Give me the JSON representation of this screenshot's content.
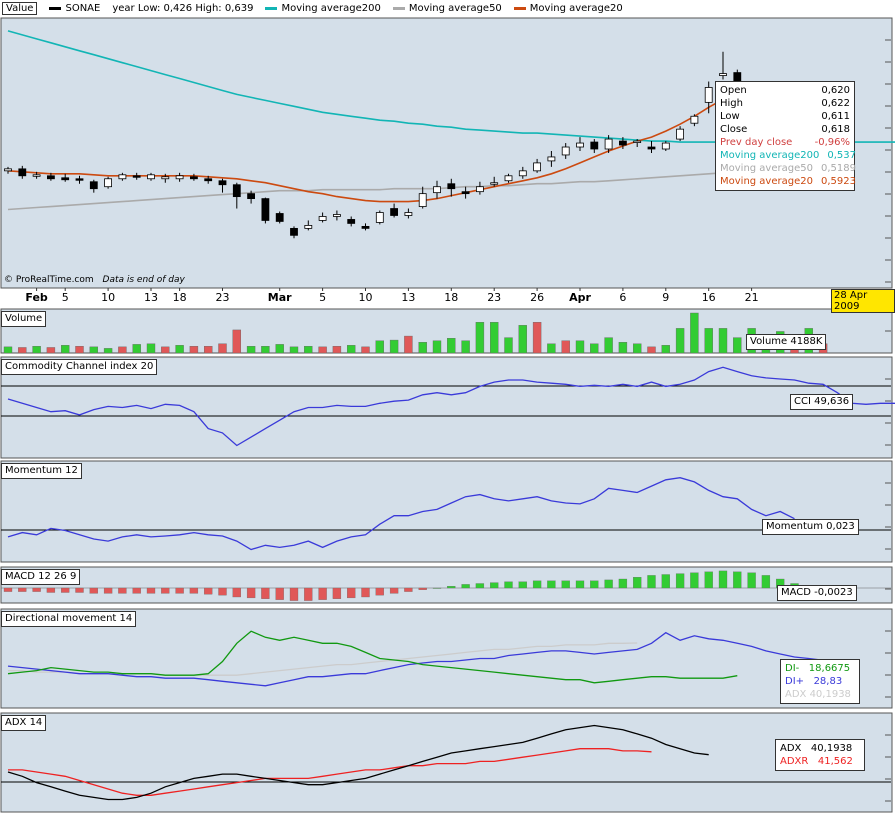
{
  "header": {
    "value_label": "Value",
    "instrument": "SONAE",
    "year_range": "year Low: 0,426 High: 0,639",
    "ma200_label": "Moving average200",
    "ma50_label": "Moving average50",
    "ma20_label": "Moving average20"
  },
  "credit": "© ProRealTime.com",
  "credit_note": "Data is end of day",
  "date_badge": "28 Apr 2009",
  "colors": {
    "bg": "#d4dfe9",
    "ma200": "#12b5b5",
    "ma50": "#aaaaaa",
    "ma20": "#cc4a10",
    "vol_up": "#33cc33",
    "vol_down": "#e05858",
    "indicator": "#3a3ad9",
    "di_minus": "#119911",
    "adxr": "#ee2222"
  },
  "xaxis_labels": [
    {
      "label": "Feb",
      "i": 2,
      "bold": true
    },
    {
      "label": "5",
      "i": 4
    },
    {
      "label": "10",
      "i": 7
    },
    {
      "label": "13",
      "i": 10
    },
    {
      "label": "18",
      "i": 12
    },
    {
      "label": "23",
      "i": 15
    },
    {
      "label": "Mar",
      "i": 19,
      "bold": true
    },
    {
      "label": "5",
      "i": 22
    },
    {
      "label": "10",
      "i": 25
    },
    {
      "label": "13",
      "i": 28
    },
    {
      "label": "18",
      "i": 31
    },
    {
      "label": "23",
      "i": 34
    },
    {
      "label": "26",
      "i": 37
    },
    {
      "label": "Apr",
      "i": 40,
      "bold": true
    },
    {
      "label": "6",
      "i": 43
    },
    {
      "label": "9",
      "i": 46
    },
    {
      "label": "16",
      "i": 49
    },
    {
      "label": "21",
      "i": 52
    }
  ],
  "tooltip": {
    "open_label": "Open",
    "open": "0,620",
    "high_label": "High",
    "high": "0,622",
    "low_label": "Low",
    "low": "0,611",
    "close_label": "Close",
    "close": "0,618",
    "prev_label": "Prev day close",
    "prev": "-0,96%",
    "ma200_label": "Moving average200",
    "ma200": "0,537",
    "ma50_label": "Moving average50",
    "ma50": "0,5189",
    "ma20_label": "Moving average20",
    "ma20": "0,5923"
  },
  "panels": {
    "volume": {
      "title": "Volume",
      "readout": "Volume 4188K"
    },
    "cci": {
      "title": "Commodity Channel index 20",
      "readout": "CCI 49,636"
    },
    "momentum": {
      "title": "Momentum 12",
      "readout": "Momentum 0,023"
    },
    "macd": {
      "title": "MACD 12 26 9",
      "readout": "MACD -0,0023"
    },
    "dm": {
      "title": "Directional movement 14",
      "di_minus": "DI-   18,6675",
      "di_plus": "DI+   28,83",
      "adx": "ADX 40,1938"
    },
    "adx": {
      "title": "ADX 14",
      "adx": "ADX   40,1938",
      "adxr": "ADXR   41,562"
    }
  },
  "chart_data": {
    "type": "candlestick",
    "instrument": "SONAE",
    "ylim": [
      0.4,
      0.66
    ],
    "candles": [
      {
        "o": 0.508,
        "h": 0.512,
        "l": 0.505,
        "c": 0.51
      },
      {
        "o": 0.51,
        "h": 0.513,
        "l": 0.5,
        "c": 0.503
      },
      {
        "o": 0.503,
        "h": 0.507,
        "l": 0.5,
        "c": 0.504
      },
      {
        "o": 0.503,
        "h": 0.506,
        "l": 0.498,
        "c": 0.5
      },
      {
        "o": 0.501,
        "h": 0.505,
        "l": 0.497,
        "c": 0.499
      },
      {
        "o": 0.5,
        "h": 0.503,
        "l": 0.495,
        "c": 0.499
      },
      {
        "o": 0.497,
        "h": 0.499,
        "l": 0.486,
        "c": 0.49
      },
      {
        "o": 0.492,
        "h": 0.502,
        "l": 0.49,
        "c": 0.5
      },
      {
        "o": 0.5,
        "h": 0.506,
        "l": 0.498,
        "c": 0.504
      },
      {
        "o": 0.503,
        "h": 0.506,
        "l": 0.499,
        "c": 0.502
      },
      {
        "o": 0.5,
        "h": 0.506,
        "l": 0.498,
        "c": 0.504
      },
      {
        "o": 0.5,
        "h": 0.505,
        "l": 0.496,
        "c": 0.502
      },
      {
        "o": 0.5,
        "h": 0.506,
        "l": 0.497,
        "c": 0.503
      },
      {
        "o": 0.502,
        "h": 0.505,
        "l": 0.498,
        "c": 0.5
      },
      {
        "o": 0.5,
        "h": 0.503,
        "l": 0.495,
        "c": 0.498
      },
      {
        "o": 0.498,
        "h": 0.5,
        "l": 0.486,
        "c": 0.494
      },
      {
        "o": 0.494,
        "h": 0.496,
        "l": 0.47,
        "c": 0.482
      },
      {
        "o": 0.485,
        "h": 0.488,
        "l": 0.475,
        "c": 0.48
      },
      {
        "o": 0.48,
        "h": 0.481,
        "l": 0.455,
        "c": 0.458
      },
      {
        "o": 0.465,
        "h": 0.467,
        "l": 0.455,
        "c": 0.457
      },
      {
        "o": 0.45,
        "h": 0.452,
        "l": 0.44,
        "c": 0.443
      },
      {
        "o": 0.45,
        "h": 0.458,
        "l": 0.448,
        "c": 0.453
      },
      {
        "o": 0.458,
        "h": 0.466,
        "l": 0.456,
        "c": 0.462
      },
      {
        "o": 0.462,
        "h": 0.468,
        "l": 0.458,
        "c": 0.464
      },
      {
        "o": 0.459,
        "h": 0.462,
        "l": 0.452,
        "c": 0.455
      },
      {
        "o": 0.452,
        "h": 0.455,
        "l": 0.448,
        "c": 0.45
      },
      {
        "o": 0.456,
        "h": 0.468,
        "l": 0.454,
        "c": 0.466
      },
      {
        "o": 0.47,
        "h": 0.475,
        "l": 0.461,
        "c": 0.463
      },
      {
        "o": 0.463,
        "h": 0.47,
        "l": 0.46,
        "c": 0.466
      },
      {
        "o": 0.472,
        "h": 0.492,
        "l": 0.47,
        "c": 0.485
      },
      {
        "o": 0.486,
        "h": 0.498,
        "l": 0.48,
        "c": 0.492
      },
      {
        "o": 0.495,
        "h": 0.5,
        "l": 0.482,
        "c": 0.49
      },
      {
        "o": 0.487,
        "h": 0.492,
        "l": 0.48,
        "c": 0.485
      },
      {
        "o": 0.487,
        "h": 0.497,
        "l": 0.484,
        "c": 0.492
      },
      {
        "o": 0.495,
        "h": 0.502,
        "l": 0.492,
        "c": 0.496
      },
      {
        "o": 0.498,
        "h": 0.505,
        "l": 0.496,
        "c": 0.503
      },
      {
        "o": 0.503,
        "h": 0.512,
        "l": 0.5,
        "c": 0.508
      },
      {
        "o": 0.508,
        "h": 0.52,
        "l": 0.506,
        "c": 0.516
      },
      {
        "o": 0.518,
        "h": 0.528,
        "l": 0.512,
        "c": 0.522
      },
      {
        "o": 0.524,
        "h": 0.536,
        "l": 0.52,
        "c": 0.532
      },
      {
        "o": 0.532,
        "h": 0.542,
        "l": 0.528,
        "c": 0.536
      },
      {
        "o": 0.537,
        "h": 0.54,
        "l": 0.526,
        "c": 0.53
      },
      {
        "o": 0.53,
        "h": 0.544,
        "l": 0.526,
        "c": 0.54
      },
      {
        "o": 0.538,
        "h": 0.542,
        "l": 0.53,
        "c": 0.534
      },
      {
        "o": 0.537,
        "h": 0.54,
        "l": 0.532,
        "c": 0.538
      },
      {
        "o": 0.532,
        "h": 0.538,
        "l": 0.526,
        "c": 0.53
      },
      {
        "o": 0.53,
        "h": 0.538,
        "l": 0.528,
        "c": 0.536
      },
      {
        "o": 0.54,
        "h": 0.553,
        "l": 0.538,
        "c": 0.55
      },
      {
        "o": 0.556,
        "h": 0.565,
        "l": 0.553,
        "c": 0.563
      },
      {
        "o": 0.577,
        "h": 0.598,
        "l": 0.566,
        "c": 0.592
      },
      {
        "o": 0.604,
        "h": 0.628,
        "l": 0.6,
        "c": 0.606
      },
      {
        "o": 0.607,
        "h": 0.61,
        "l": 0.588,
        "c": 0.592
      }
    ],
    "ma200": [
      0.649,
      0.645,
      0.641,
      0.637,
      0.633,
      0.629,
      0.625,
      0.621,
      0.617,
      0.613,
      0.609,
      0.605,
      0.601,
      0.597,
      0.593,
      0.589,
      0.585,
      0.582,
      0.579,
      0.576,
      0.573,
      0.57,
      0.567,
      0.565,
      0.563,
      0.561,
      0.559,
      0.558,
      0.556,
      0.555,
      0.553,
      0.552,
      0.55,
      0.549,
      0.548,
      0.547,
      0.546,
      0.546,
      0.545,
      0.544,
      0.543,
      0.542,
      0.541,
      0.54,
      0.539,
      0.538,
      0.538,
      0.537,
      0.537,
      0.537,
      0.537,
      0.537,
      0.537,
      0.537,
      0.537,
      0.537,
      0.537,
      0.537,
      0.537,
      0.537,
      0.537,
      0.537,
      0.537,
      0.537,
      0.537,
      0.537,
      0.537,
      0.537,
      0.537,
      0.537,
      0.537,
      0.537,
      0.537
    ],
    "ma50": [
      0.469,
      0.47,
      0.471,
      0.472,
      0.473,
      0.474,
      0.475,
      0.476,
      0.477,
      0.478,
      0.479,
      0.48,
      0.481,
      0.482,
      0.483,
      0.484,
      0.485,
      0.486,
      0.487,
      0.488,
      0.488,
      0.488,
      0.489,
      0.489,
      0.489,
      0.489,
      0.489,
      0.49,
      0.49,
      0.49,
      0.49,
      0.491,
      0.492,
      0.492,
      0.493,
      0.493,
      0.494,
      0.495,
      0.495,
      0.496,
      0.497,
      0.497,
      0.498,
      0.499,
      0.5,
      0.501,
      0.502,
      0.503,
      0.504,
      0.505,
      0.506,
      0.508,
      0.51,
      0.512,
      0.514,
      0.516,
      0.518,
      0.519
    ],
    "ma20": [
      0.508,
      0.507,
      0.506,
      0.505,
      0.505,
      0.505,
      0.504,
      0.503,
      0.503,
      0.503,
      0.503,
      0.503,
      0.503,
      0.503,
      0.502,
      0.501,
      0.5,
      0.498,
      0.496,
      0.493,
      0.49,
      0.487,
      0.485,
      0.482,
      0.48,
      0.478,
      0.477,
      0.477,
      0.477,
      0.478,
      0.48,
      0.483,
      0.486,
      0.489,
      0.492,
      0.495,
      0.498,
      0.501,
      0.505,
      0.51,
      0.516,
      0.522,
      0.528,
      0.533,
      0.538,
      0.542,
      0.548,
      0.555,
      0.563,
      0.572,
      0.58,
      0.588,
      0.592
    ],
    "volume": [
      {
        "v": 0.2,
        "u": true
      },
      {
        "v": 0.18,
        "u": false
      },
      {
        "v": 0.22,
        "u": true
      },
      {
        "v": 0.18,
        "u": false
      },
      {
        "v": 0.25,
        "u": true
      },
      {
        "v": 0.22,
        "u": false
      },
      {
        "v": 0.2,
        "u": true
      },
      {
        "v": 0.15,
        "u": true
      },
      {
        "v": 0.2,
        "u": false
      },
      {
        "v": 0.28,
        "u": true
      },
      {
        "v": 0.3,
        "u": true
      },
      {
        "v": 0.2,
        "u": false
      },
      {
        "v": 0.25,
        "u": true
      },
      {
        "v": 0.22,
        "u": false
      },
      {
        "v": 0.22,
        "u": false
      },
      {
        "v": 0.3,
        "u": false
      },
      {
        "v": 0.75,
        "u": false
      },
      {
        "v": 0.22,
        "u": true
      },
      {
        "v": 0.22,
        "u": true
      },
      {
        "v": 0.28,
        "u": true
      },
      {
        "v": 0.2,
        "u": true
      },
      {
        "v": 0.22,
        "u": true
      },
      {
        "v": 0.2,
        "u": false
      },
      {
        "v": 0.22,
        "u": false
      },
      {
        "v": 0.25,
        "u": true
      },
      {
        "v": 0.2,
        "u": false
      },
      {
        "v": 0.4,
        "u": true
      },
      {
        "v": 0.42,
        "u": true
      },
      {
        "v": 0.55,
        "u": false
      },
      {
        "v": 0.35,
        "u": true
      },
      {
        "v": 0.4,
        "u": true
      },
      {
        "v": 0.48,
        "u": true
      },
      {
        "v": 0.4,
        "u": true
      },
      {
        "v": 1.0,
        "u": true
      },
      {
        "v": 1.0,
        "u": true
      },
      {
        "v": 0.5,
        "u": true
      },
      {
        "v": 0.9,
        "u": true
      },
      {
        "v": 1.0,
        "u": false
      },
      {
        "v": 0.3,
        "u": true
      },
      {
        "v": 0.4,
        "u": false
      },
      {
        "v": 0.4,
        "u": true
      },
      {
        "v": 0.3,
        "u": true
      },
      {
        "v": 0.5,
        "u": true
      },
      {
        "v": 0.35,
        "u": true
      },
      {
        "v": 0.3,
        "u": true
      },
      {
        "v": 0.2,
        "u": false
      },
      {
        "v": 0.25,
        "u": true
      },
      {
        "v": 0.8,
        "u": true
      },
      {
        "v": 1.3,
        "u": true
      },
      {
        "v": 0.8,
        "u": true
      },
      {
        "v": 0.8,
        "u": true
      },
      {
        "v": 0.5,
        "u": true
      },
      {
        "v": 0.8,
        "u": true
      },
      {
        "v": 0.5,
        "u": true
      },
      {
        "v": 0.7,
        "u": true
      },
      {
        "v": 0.3,
        "u": false
      },
      {
        "v": 0.8,
        "u": true
      },
      {
        "v": 0.3,
        "u": false
      }
    ],
    "cci": [
      80,
      60,
      40,
      20,
      25,
      5,
      30,
      45,
      40,
      50,
      35,
      55,
      50,
      20,
      -60,
      -80,
      -140,
      -100,
      -60,
      -20,
      20,
      40,
      40,
      50,
      45,
      45,
      60,
      70,
      75,
      100,
      110,
      100,
      110,
      140,
      160,
      170,
      170,
      160,
      155,
      150,
      140,
      145,
      140,
      150,
      140,
      160,
      140,
      150,
      170,
      210,
      230,
      210,
      190,
      180,
      175,
      170,
      155,
      150,
      110,
      60,
      55,
      60,
      60,
      50
    ],
    "momentum": [
      -0.02,
      -0.01,
      -0.015,
      0.0,
      -0.005,
      -0.015,
      -0.025,
      -0.03,
      -0.02,
      -0.015,
      -0.02,
      -0.018,
      -0.015,
      -0.01,
      -0.015,
      -0.018,
      -0.03,
      -0.05,
      -0.04,
      -0.045,
      -0.04,
      -0.03,
      -0.045,
      -0.03,
      -0.02,
      -0.015,
      0.01,
      0.03,
      0.03,
      0.04,
      0.045,
      0.06,
      0.075,
      0.08,
      0.07,
      0.065,
      0.07,
      0.075,
      0.065,
      0.06,
      0.058,
      0.07,
      0.095,
      0.09,
      0.085,
      0.1,
      0.115,
      0.12,
      0.11,
      0.09,
      0.075,
      0.07,
      0.045,
      0.03,
      0.04,
      0.023
    ],
    "macd": [
      -0.004,
      -0.004,
      -0.004,
      -0.005,
      -0.005,
      -0.005,
      -0.006,
      -0.006,
      -0.006,
      -0.006,
      -0.006,
      -0.006,
      -0.006,
      -0.006,
      -0.007,
      -0.008,
      -0.01,
      -0.011,
      -0.012,
      -0.013,
      -0.014,
      -0.014,
      -0.013,
      -0.012,
      -0.011,
      -0.01,
      -0.008,
      -0.006,
      -0.004,
      -0.002,
      0.0,
      0.002,
      0.004,
      0.005,
      0.006,
      0.007,
      0.007,
      0.008,
      0.008,
      0.008,
      0.008,
      0.008,
      0.009,
      0.01,
      0.012,
      0.014,
      0.015,
      0.016,
      0.017,
      0.018,
      0.019,
      0.018,
      0.017,
      0.014,
      0.01,
      0.005,
      -0.001,
      -0.0023
    ],
    "di_plus": [
      25,
      24,
      23,
      22,
      21,
      20,
      20,
      20,
      19,
      18,
      18,
      17,
      17,
      17,
      16,
      15,
      14,
      13,
      12,
      14,
      16,
      18,
      18,
      19,
      20,
      20,
      22,
      24,
      26,
      27,
      28,
      28,
      29,
      30,
      30,
      32,
      33,
      34,
      35,
      35,
      34,
      33,
      34,
      35,
      36,
      40,
      47,
      42,
      45,
      43,
      42,
      40,
      38,
      35,
      33,
      31,
      30,
      28.83
    ],
    "di_minus": [
      20,
      21,
      22,
      24,
      23,
      22,
      21,
      21,
      20,
      20,
      20,
      19,
      19,
      19,
      20,
      28,
      40,
      48,
      44,
      42,
      44,
      42,
      40,
      40,
      38,
      34,
      30,
      29,
      28,
      26,
      25,
      24,
      23,
      22,
      21,
      20,
      19,
      18,
      17,
      16,
      16,
      14,
      15,
      16,
      17,
      18,
      18,
      17,
      17,
      17,
      17,
      18.6675
    ],
    "adx_dm": [
      22,
      22,
      21,
      21,
      21,
      20,
      20,
      20,
      20,
      20,
      20,
      19,
      19,
      19,
      19,
      19,
      19,
      20,
      21,
      22,
      23,
      24,
      25,
      26,
      26,
      27,
      28,
      29,
      30,
      31,
      32,
      33,
      34,
      35,
      36,
      36,
      37,
      38,
      38,
      39,
      39,
      39,
      40,
      40,
      40.1938
    ],
    "adx": [
      32,
      30,
      27,
      25,
      23,
      21,
      20,
      19,
      19,
      20,
      22,
      25,
      27,
      29,
      30,
      31,
      31,
      30,
      29,
      28,
      27,
      26,
      26,
      27,
      28,
      29,
      31,
      33,
      35,
      37,
      39,
      41,
      42,
      43,
      44,
      45,
      46,
      48,
      50,
      52,
      53,
      54,
      53,
      52,
      50,
      48,
      45,
      43,
      41,
      40.1938
    ],
    "adxr": [
      33,
      33,
      32,
      31,
      30,
      28,
      26,
      24,
      22,
      21,
      21,
      22,
      23,
      24,
      25,
      26,
      27,
      28,
      29,
      29,
      29,
      29,
      30,
      31,
      32,
      33,
      33,
      34,
      35,
      35,
      36,
      36,
      36,
      37,
      37,
      38,
      39,
      40,
      41,
      42,
      43,
      43,
      43,
      42,
      42,
      41.562
    ]
  }
}
